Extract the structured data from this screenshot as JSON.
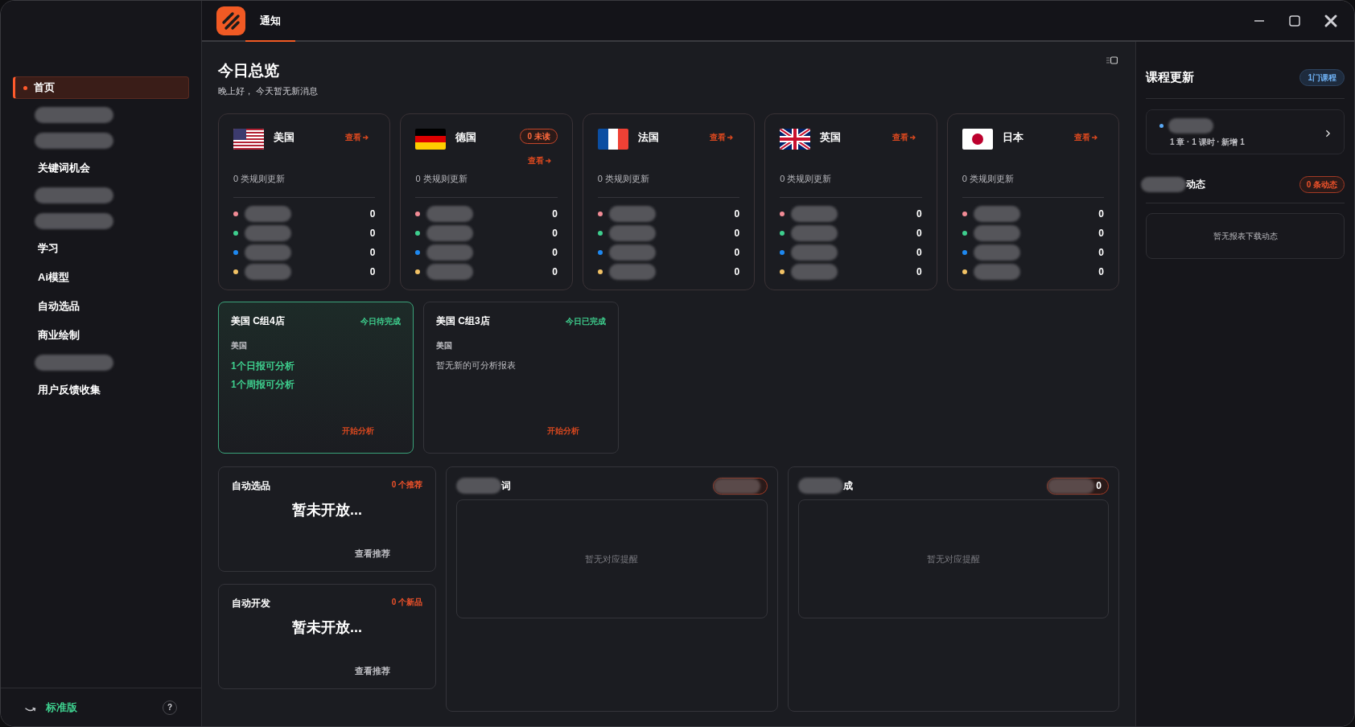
{
  "header": {
    "tabs": [
      {
        "label": "通知",
        "selected": true
      }
    ]
  },
  "sidebar": {
    "items": [
      {
        "kind": "text",
        "label": "首页",
        "selected": true
      },
      {
        "kind": "redacted",
        "selected": false
      },
      {
        "kind": "redacted",
        "selected": false
      },
      {
        "kind": "text",
        "label": "关键词机会",
        "selected": false
      },
      {
        "kind": "redacted",
        "selected": false
      },
      {
        "kind": "redacted",
        "selected": false
      },
      {
        "kind": "text",
        "label": "学习",
        "selected": false
      },
      {
        "kind": "text",
        "label": "Ai模型",
        "selected": false
      },
      {
        "kind": "text",
        "label": "自动选品",
        "selected": false
      },
      {
        "kind": "text",
        "label": "商业绘制",
        "selected": false
      },
      {
        "kind": "redacted",
        "selected": false
      },
      {
        "kind": "text",
        "label": "用户反馈收集",
        "selected": false
      }
    ],
    "footer": {
      "plan": "标准版",
      "help": "?"
    }
  },
  "overview": {
    "title": "今日总览",
    "subtitle": "晚上好， 今天暂无新消息"
  },
  "countries": [
    {
      "name": "美国",
      "kind": "us",
      "link": "查看",
      "rules": "0 类规则更新",
      "rows": [
        {
          "color": "#f28b95",
          "value": "0"
        },
        {
          "color": "#3ecf8e",
          "value": "0"
        },
        {
          "color": "#1e88f0",
          "value": "0"
        },
        {
          "color": "#f2c265",
          "value": "0"
        }
      ]
    },
    {
      "name": "德国",
      "kind": "de",
      "badge": "0 未读",
      "link": "查看",
      "rules": "0 类规则更新",
      "rows": [
        {
          "color": "#f28b95",
          "value": "0"
        },
        {
          "color": "#3ecf8e",
          "value": "0"
        },
        {
          "color": "#1e88f0",
          "value": "0"
        },
        {
          "color": "#f2c265",
          "value": "0"
        }
      ]
    },
    {
      "name": "法国",
      "kind": "fr",
      "link": "查看",
      "rules": "0 类规则更新",
      "rows": [
        {
          "color": "#f28b95",
          "value": "0"
        },
        {
          "color": "#3ecf8e",
          "value": "0"
        },
        {
          "color": "#1e88f0",
          "value": "0"
        },
        {
          "color": "#f2c265",
          "value": "0"
        }
      ]
    },
    {
      "name": "英国",
      "kind": "gb",
      "link": "查看",
      "rules": "0 类规则更新",
      "rows": [
        {
          "color": "#f28b95",
          "value": "0"
        },
        {
          "color": "#3ecf8e",
          "value": "0"
        },
        {
          "color": "#1e88f0",
          "value": "0"
        },
        {
          "color": "#f2c265",
          "value": "0"
        }
      ]
    },
    {
      "name": "日本",
      "kind": "jp",
      "link": "查看",
      "rules": "0 类规则更新",
      "rows": [
        {
          "color": "#f28b95",
          "value": "0"
        },
        {
          "color": "#3ecf8e",
          "value": "0"
        },
        {
          "color": "#1e88f0",
          "value": "0"
        },
        {
          "color": "#f2c265",
          "value": "0"
        }
      ]
    }
  ],
  "stores": [
    {
      "title": "美国 C组4店",
      "status": "今日待完成",
      "selected": true,
      "country": "美国",
      "lines": [
        {
          "kind": "highlight",
          "text": "1个日报可分析"
        },
        {
          "kind": "highlight",
          "text": "1个周报可分析"
        }
      ],
      "action": "开始分析"
    },
    {
      "title": "美国 C组3店",
      "status": "今日已完成",
      "selected": false,
      "country": "美国",
      "lines": [
        {
          "kind": "muted",
          "text": "暂无新的可分析报表"
        }
      ],
      "action": "开始分析"
    }
  ],
  "features": [
    {
      "title": "自动选品",
      "badge": "0 个推荐",
      "message": "暂未开放...",
      "link": "查看推荐"
    },
    {
      "title": "自动开发",
      "badge": "0 个新品",
      "message": "暂未开放...",
      "link": "查看推荐"
    }
  ],
  "alert_panels": [
    {
      "title_visible": "词",
      "empty": "暂无对应提醒"
    },
    {
      "title_visible": "成",
      "badge_visible": "0",
      "empty": "暂无对应提醒"
    }
  ],
  "right_panel": {
    "course": {
      "title": "课程更新",
      "badge": "1门课程",
      "item": {
        "color": "#5aa9f5",
        "meta": "1 章 · 1 课时 · 新增 1"
      }
    },
    "downloads": {
      "title_visible": "动态",
      "badge": "0 条动态",
      "empty": "暂无报表下载动态"
    }
  }
}
